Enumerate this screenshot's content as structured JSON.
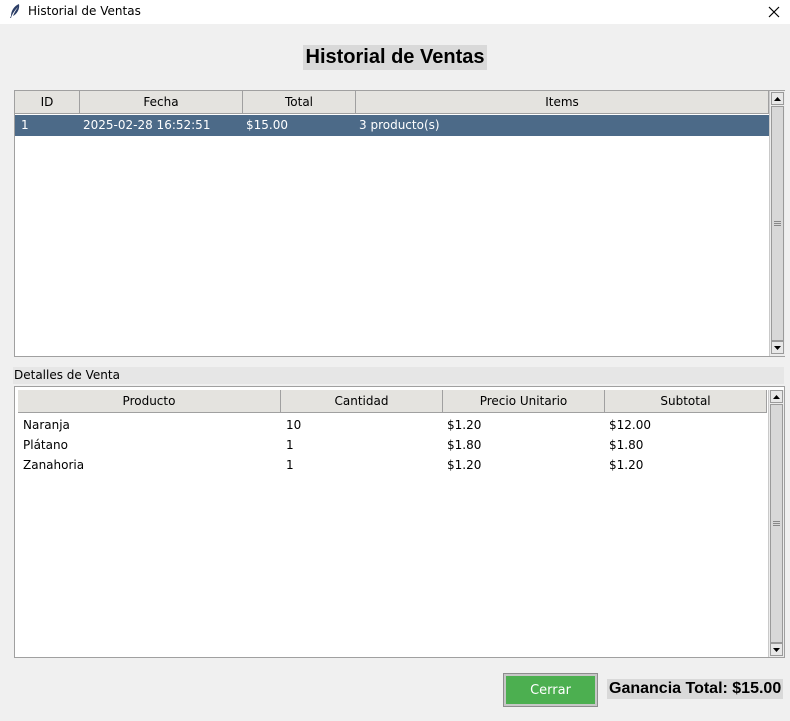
{
  "window": {
    "title": "Historial de Ventas",
    "close_glyph": "✕"
  },
  "heading": "Historial de Ventas",
  "sales_table": {
    "columns": [
      "ID",
      "Fecha",
      "Total",
      "Items"
    ],
    "rows": [
      {
        "id": "1",
        "fecha": "2025-02-28 16:52:51",
        "total": "$15.00",
        "items": "3 producto(s)",
        "selected": true
      }
    ]
  },
  "details": {
    "label": "Detalles de Venta",
    "columns": [
      "Producto",
      "Cantidad",
      "Precio Unitario",
      "Subtotal"
    ],
    "rows": [
      {
        "producto": "Naranja",
        "cantidad": "10",
        "precio": "$1.20",
        "subtotal": "$12.00"
      },
      {
        "producto": "Plátano",
        "cantidad": "1",
        "precio": "$1.80",
        "subtotal": "$1.80"
      },
      {
        "producto": "Zanahoria",
        "cantidad": "1",
        "precio": "$1.20",
        "subtotal": "$1.20"
      }
    ]
  },
  "buttons": {
    "close_label": "Cerrar"
  },
  "total_label": "Ganancia Total: $15.00",
  "colors": {
    "selected_row": "#4c6a88",
    "close_button": "#4caf50"
  },
  "icons": {
    "app": "feather-icon",
    "close": "close-icon",
    "scroll_up": "arrow-up-icon",
    "scroll_down": "arrow-down-icon"
  }
}
